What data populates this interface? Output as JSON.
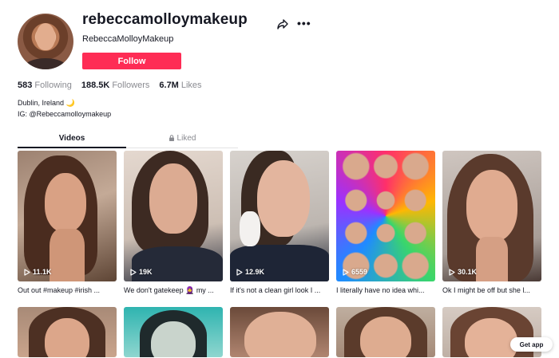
{
  "profile": {
    "username": "rebeccamolloymakeup",
    "display_name": "RebeccaMolloyMakeup",
    "follow_label": "Follow",
    "stats": [
      {
        "value": "583",
        "label": "Following"
      },
      {
        "value": "188.5K",
        "label": "Followers"
      },
      {
        "value": "6.7M",
        "label": "Likes"
      }
    ],
    "bio_line1": "Dublin, Ireland 🌙",
    "bio_line2": "IG: @Rebeccamolloymakeup"
  },
  "tabs": {
    "videos": "Videos",
    "liked": "Liked"
  },
  "videos": [
    {
      "views": "11.1K",
      "caption": "Out out #makeup #irish ..."
    },
    {
      "views": "19K",
      "caption": "We don't gatekeep 🧕 my ..."
    },
    {
      "views": "12.9K",
      "caption": "If it's not a clean girl look I ..."
    },
    {
      "views": "6559",
      "caption": "I literally have no idea whi..."
    },
    {
      "views": "30.1K",
      "caption": "Ok I might be off but she l..."
    }
  ],
  "get_app_label": "Get app",
  "colors": {
    "brand": "#fe2c55",
    "text": "#161823",
    "muted": "#8a8b91"
  }
}
